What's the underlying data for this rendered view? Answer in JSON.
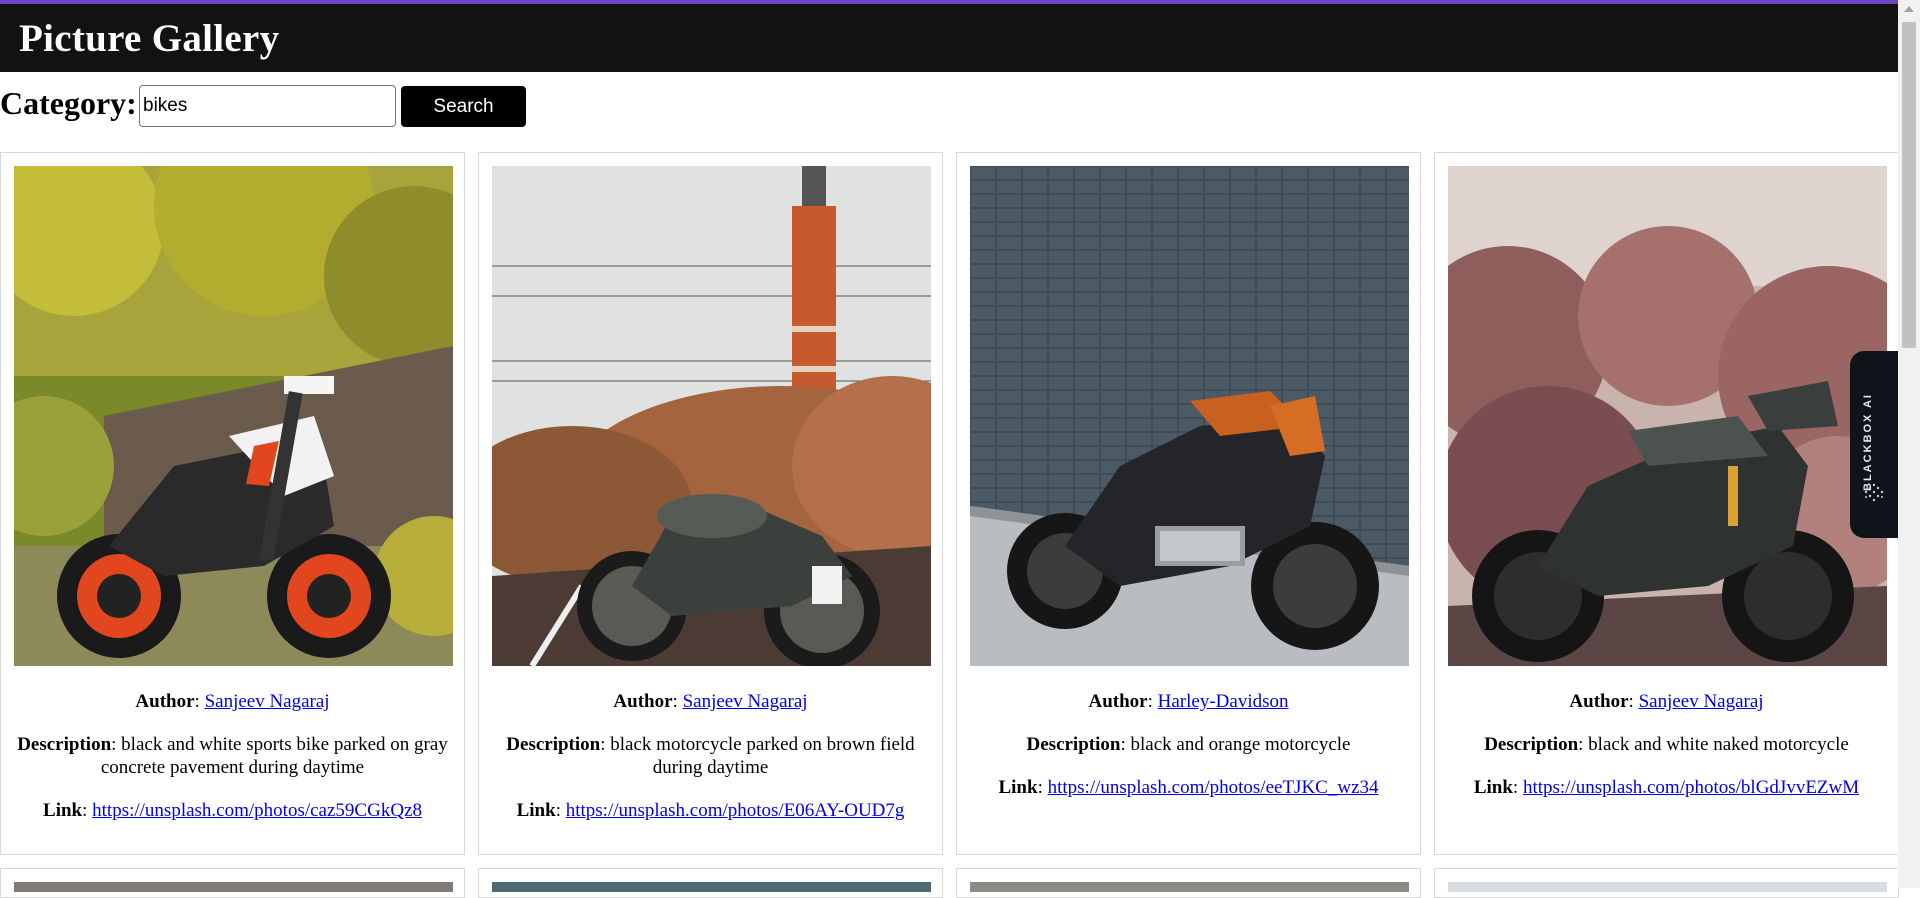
{
  "app": {
    "title": "Picture Gallery"
  },
  "search": {
    "label": "Category:",
    "value": "bikes",
    "button": "Search"
  },
  "labels": {
    "author": "Author",
    "description": "Description",
    "link": "Link"
  },
  "cards": [
    {
      "author": "Sanjeev Nagaraj",
      "description": "black and white sports bike parked on gray concrete pavement during daytime",
      "link": "https://unsplash.com/photos/caz59CGkQz8"
    },
    {
      "author": "Sanjeev Nagaraj",
      "description": "black motorcycle parked on brown field during daytime",
      "link": "https://unsplash.com/photos/E06AY-OUD7g"
    },
    {
      "author": "Harley-Davidson",
      "description": "black and orange motorcycle",
      "link": "https://unsplash.com/photos/eeTJKC_wz34"
    },
    {
      "author": "Sanjeev Nagaraj",
      "description": "black and white naked motorcycle",
      "link": "https://unsplash.com/photos/blGdJvvEZwM"
    }
  ],
  "sidebar_widget": {
    "label": "BLACKBOX AI"
  },
  "colors": {
    "header_bg": "#121212",
    "accent_top": "#6f42c1",
    "link": "#0000ee"
  }
}
